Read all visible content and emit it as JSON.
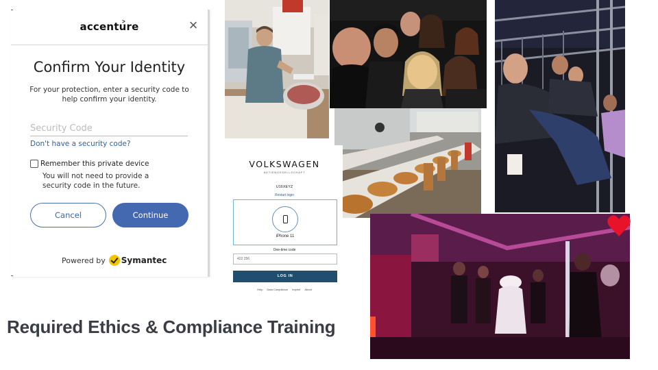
{
  "accenture": {
    "logo_text": "accenture",
    "logo_mark": ">",
    "close_glyph": "×",
    "title": "Confirm Your Identity",
    "description": "For your protection, enter a security code to help confirm your identity.",
    "security_code_placeholder": "Security Code",
    "no_code_link": "Don't have a security code?",
    "remember_label": "Remember this private device",
    "remember_desc": "You will not need to provide a security code in the future.",
    "cancel_label": "Cancel",
    "continue_label": "Continue",
    "powered_by": "Powered by",
    "symantec": "Symantec",
    "accent_color": "#4469b0"
  },
  "volkswagen": {
    "brand": "VOLKSWAGEN",
    "subbrand": "AKTIENGESELLSCHAFT",
    "user_id": "U16XEYZ",
    "restart_link": "Restart login",
    "device_name": "iPhone 11",
    "otp_label": "One-time code",
    "otp_value": "422 256",
    "login_label": "LOG IN",
    "footer_links": [
      "Help",
      "Data Compliance",
      "Imprint",
      "About"
    ],
    "button_color": "#1f4e6f"
  },
  "caption": "Required Ethics & Compliance Training",
  "icons": [
    "close-icon",
    "symantec-check-icon",
    "smartphone-icon",
    "heart-icon"
  ]
}
